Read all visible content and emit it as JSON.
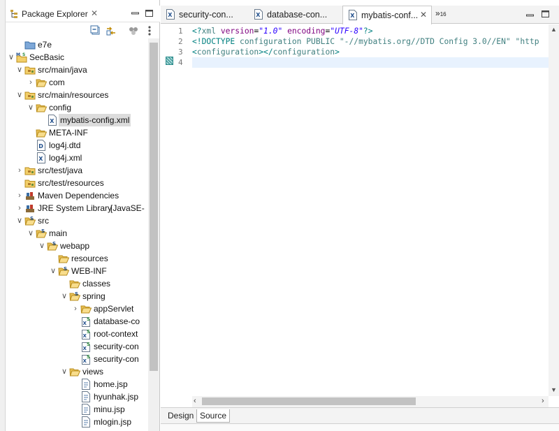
{
  "explorer": {
    "title": "Package Explorer",
    "close_glyph": "✕",
    "toolbar": [
      "collapse-all-icon",
      "link-with-editor-icon",
      "focus-icon",
      "view-menu-icon"
    ],
    "tree": [
      {
        "label": "e7e",
        "icon": "project-folder-icon",
        "twisty": ""
      },
      {
        "label": "SecBasic",
        "icon": "maven-project-icon",
        "twisty": "v"
      },
      {
        "label": "src/main/java",
        "icon": "source-folder-icon",
        "twisty": "v"
      },
      {
        "label": "com",
        "icon": "package-icon",
        "twisty": ">"
      },
      {
        "label": "src/main/resources",
        "icon": "source-folder-icon",
        "twisty": "v"
      },
      {
        "label": "config",
        "icon": "folder-open-icon",
        "twisty": "v"
      },
      {
        "label": "mybatis-config.xml",
        "icon": "xml-file-icon",
        "twisty": ""
      },
      {
        "label": "META-INF",
        "icon": "folder-icon",
        "twisty": ""
      },
      {
        "label": "log4j.dtd",
        "icon": "dtd-file-icon",
        "twisty": ""
      },
      {
        "label": "log4j.xml",
        "icon": "xml-file-icon",
        "twisty": ""
      },
      {
        "label": "src/test/java",
        "icon": "source-folder-icon",
        "twisty": ">"
      },
      {
        "label": "src/test/resources",
        "icon": "source-folder-icon",
        "twisty": ""
      },
      {
        "label": "Maven Dependencies",
        "icon": "library-icon",
        "twisty": ">"
      },
      {
        "label": "JRE System Library",
        "suffix": "[JavaSE-",
        "icon": "library-icon",
        "twisty": ">"
      },
      {
        "label": "src",
        "icon": "spring-folder-icon",
        "twisty": "v"
      },
      {
        "label": "main",
        "icon": "spring-folder-icon",
        "twisty": "v"
      },
      {
        "label": "webapp",
        "icon": "spring-folder-icon",
        "twisty": "v"
      },
      {
        "label": "resources",
        "icon": "folder-icon",
        "twisty": ""
      },
      {
        "label": "WEB-INF",
        "icon": "spring-folder-icon",
        "twisty": "v"
      },
      {
        "label": "classes",
        "icon": "folder-icon",
        "twisty": ""
      },
      {
        "label": "spring",
        "icon": "spring-folder-icon",
        "twisty": "v"
      },
      {
        "label": "appServlet",
        "icon": "folder-icon",
        "twisty": ">"
      },
      {
        "label": "database-co",
        "icon": "spring-xml-icon",
        "twisty": ""
      },
      {
        "label": "root-context",
        "icon": "spring-xml-icon",
        "twisty": ""
      },
      {
        "label": "security-con",
        "icon": "spring-xml-icon",
        "twisty": ""
      },
      {
        "label": "security-con",
        "icon": "spring-xml-icon",
        "twisty": ""
      },
      {
        "label": "views",
        "icon": "folder-open-icon",
        "twisty": "v"
      },
      {
        "label": "home.jsp",
        "icon": "jsp-file-icon",
        "twisty": ""
      },
      {
        "label": "hyunhak.jsp",
        "icon": "jsp-file-icon",
        "twisty": ""
      },
      {
        "label": "minu.jsp",
        "icon": "jsp-file-icon",
        "twisty": ""
      },
      {
        "label": "mlogin.jsp",
        "icon": "jsp-file-icon",
        "twisty": ""
      }
    ]
  },
  "editor": {
    "tabs": [
      {
        "label": "security-con..."
      },
      {
        "label": "database-con..."
      },
      {
        "label": "mybatis-conf...",
        "active": true,
        "close": "✕"
      }
    ],
    "overflow_label": "»",
    "overflow_count": "16",
    "line_numbers": [
      "1",
      "2",
      "3",
      "4"
    ],
    "lines": {
      "l1": {
        "lt": "<?",
        "tag": "xml",
        "a1": "version",
        "eq1": "=",
        "v1": "\"1.0\"",
        "a2": "encoding",
        "eq2": "=",
        "v2": "\"UTF-8\"",
        "end": "?>"
      },
      "l2": {
        "open": "<!DOCTYPE ",
        "name": "configuration",
        "pub": " PUBLIC ",
        "s1": "\"-//mybatis.org//DTD Config 3.0//EN\"",
        "s2": " \"http"
      },
      "l3": {
        "o1": "<",
        "t1": "configuration",
        "c1": "></",
        "t2": "configuration",
        "c2": ">"
      }
    },
    "bottom_tabs": {
      "design": "Design",
      "source": "Source"
    }
  }
}
